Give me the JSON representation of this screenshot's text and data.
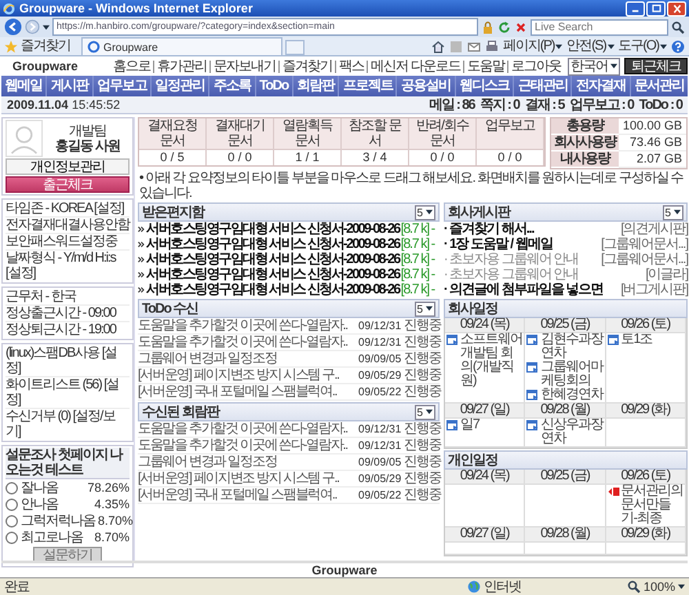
{
  "browser": {
    "title": "Groupware - Windows Internet Explorer",
    "url": "https://m.hanbiro.com/groupware/?category=index&section=main",
    "search_placeholder": "Live Search",
    "favorites": "즐겨찾기",
    "tab": "Groupware",
    "tools": [
      "페이지(P)",
      "안전(S)",
      "도구(O)"
    ]
  },
  "header": {
    "logo": "Groupware",
    "links": [
      "홈으로",
      "휴가관리",
      "문자보내기",
      "즐겨찾기",
      "팩스",
      "메신저 다운로드",
      "도움말",
      "로그아웃"
    ],
    "language": "한국어",
    "checkout_button": "퇴근체크"
  },
  "nav": [
    {
      "label": "웹메일"
    },
    {
      "label": "게시판"
    },
    {
      "label": "업무보고"
    },
    {
      "label": "일정관리"
    },
    {
      "label": "주소록"
    },
    {
      "label": "ToDo"
    },
    {
      "label": "회람판"
    },
    {
      "label": "프로젝트"
    },
    {
      "label": "공용설비"
    },
    {
      "label": "웹디스크"
    },
    {
      "label": "근태관리"
    },
    {
      "label": "전자결재"
    },
    {
      "label": "문서관리"
    }
  ],
  "datetime": {
    "date": "2009.11.04",
    "time": "15:45:52"
  },
  "counters": [
    {
      "label": "메일 :",
      "value": "86"
    },
    {
      "label": "쪽지 :",
      "value": "0"
    },
    {
      "label": "결재 :",
      "value": "5"
    },
    {
      "label": "업무보고 :",
      "value": "0"
    },
    {
      "label": "ToDo :",
      "value": "0"
    }
  ],
  "profile": {
    "team": "개발팀",
    "name": "홍길동 사원",
    "info_button": "개인정보관리",
    "checkin_button": "출근체크"
  },
  "settings_groups": [
    {
      "items": [
        "타임존 - KOREA [설정]",
        "전자결재대결사용안함",
        "보안패스워드설정중",
        "날짜형식 - Y/m/d H:i:s [설정]"
      ]
    },
    {
      "items": [
        "근무처 - 한국",
        "정상출근시간 - 09:00",
        "정상퇴근시간 - 19:00"
      ]
    },
    {
      "items": [
        "(linux)스팸DB사용 [설정]",
        "화이트리스트 (56) [설정]",
        "수신거부 (0) [설정/보기]"
      ]
    }
  ],
  "survey": {
    "title": "설문조사 첫페이지 나오는것 테스트",
    "options": [
      {
        "label": "잘나옴",
        "percent": "78.26%",
        "selected": false
      },
      {
        "label": "안나옴",
        "percent": "4.35%",
        "selected": false
      },
      {
        "label": "그럭저럭나옴",
        "percent": "8.70%",
        "selected": false
      },
      {
        "label": "최고로나옴",
        "percent": "8.70%",
        "selected": false
      }
    ],
    "button": "설문하기",
    "button_disabled": true
  },
  "summary": [
    {
      "label": "결재요청 문서",
      "value": "0 / 5"
    },
    {
      "label": "결재대기 문서",
      "value": "0 / 0"
    },
    {
      "label": "열람획득 문서",
      "value": "1 / 1"
    },
    {
      "label": "참조할 문서",
      "value": "3 / 4"
    },
    {
      "label": "반려/회수 문서",
      "value": "0 / 0"
    },
    {
      "label": "업무보고",
      "value": "0 / 0"
    }
  ],
  "storage": [
    {
      "label": "총용량",
      "value": "100.00 GB"
    },
    {
      "label": "회사사용량",
      "value": "73.46 GB"
    },
    {
      "label": "내사용량",
      "value": "2.07 GB"
    }
  ],
  "note": "• 아래 각 요약정보의 타이틀 부분을 마우스로 드래그 해보세요. 화면배치를 원하시는데로 구성하실 수 있습니다.",
  "inbox": {
    "title": "받은편지함",
    "count": "5",
    "items": [
      {
        "title": "서버호스팅영구임대형 서비스 신청서-2009-08-26",
        "size": "[8.7 k] -"
      },
      {
        "title": "서버호스팅영구임대형 서비스 신청서-2009-08-26",
        "size": "[8.7 k] -"
      },
      {
        "title": "서버호스팅영구임대형 서비스 신청서-2009-08-26",
        "size": "[8.7 k] -"
      },
      {
        "title": "서버호스팅영구임대형 서비스 신청서-2009-08-26",
        "size": "[8.7 k] -"
      },
      {
        "title": "서버호스팅영구임대형 서비스 신청서-2009-08-26",
        "size": "[8.7 k] -"
      }
    ]
  },
  "todo": {
    "title": "ToDo 수신",
    "count": "5",
    "rows": [
      {
        "title": "도움말을 추가할것 이곳에 쓴다-열람자..",
        "date": "09/12/31",
        "status": "진행중"
      },
      {
        "title": "도움말을 추가할것 이곳에 쓴다-열람자..",
        "date": "09/12/31",
        "status": "진행중"
      },
      {
        "title": "그룹웨어 변경과 일정조정",
        "date": "09/09/05",
        "status": "진행중"
      },
      {
        "title": "[서버운영] 페이지변조 방지 시스템 구..",
        "date": "09/05/29",
        "status": "진행중"
      },
      {
        "title": "[서버운영] 국내 포털메일 스팸블럭여..",
        "date": "09/05/22",
        "status": "진행중"
      }
    ]
  },
  "circular": {
    "title": "수신된 회람판",
    "count": "5",
    "rows": [
      {
        "title": "도움말을 추가할것 이곳에 쓴다-열람자..",
        "date": "09/12/31",
        "status": "진행중"
      },
      {
        "title": "도움말을 추가할것 이곳에 쓴다-열람자..",
        "date": "09/12/31",
        "status": "진행중"
      },
      {
        "title": "그룹웨어 변경과 일정조정",
        "date": "09/09/05",
        "status": "진행중"
      },
      {
        "title": "[서버운영] 페이지변조 방지 시스템 구..",
        "date": "09/05/29",
        "status": "진행중"
      },
      {
        "title": "[서버운영] 국내 포털메일 스팸블럭여..",
        "date": "09/05/22",
        "status": "진행중"
      }
    ]
  },
  "board": {
    "title": "회사게시판",
    "count": "5",
    "items": [
      {
        "title": "· 즐겨찾기 해서...",
        "board": "[의견게시판]",
        "unread": true
      },
      {
        "title": "· 1장 도움말 / 웹메일",
        "board": "[그룹웨어문서...]",
        "unread": true
      },
      {
        "title": "· 초보자용 그룹웨어 안내",
        "board": "[그룹웨어문서...]",
        "unread": false
      },
      {
        "title": "· 초보자용 그룹웨어 안내",
        "board": "[이글라]",
        "unread": false
      },
      {
        "title": "· 의견글에 첨부파일을 넣으면",
        "board": "[버그게시판]",
        "unread": true
      }
    ]
  },
  "company_schedule": {
    "title": "회사일정",
    "weeks": [
      {
        "days": [
          {
            "date": "09/24 (목)",
            "events": [
              {
                "text": "소프트웨어개발팀 회의(개발직원)",
                "kind": "company"
              }
            ]
          },
          {
            "date": "09/25 (금)",
            "events": [
              {
                "text": "김현수과장 연차",
                "kind": "company"
              },
              {
                "text": "그룹웨어마케팅회의",
                "kind": "company"
              },
              {
                "text": "한혜경연차",
                "kind": "company"
              }
            ]
          },
          {
            "date": "09/26 (토)",
            "events": [
              {
                "text": "토1조",
                "kind": "company"
              }
            ]
          }
        ]
      },
      {
        "days": [
          {
            "date": "09/27 (일)",
            "events": [
              {
                "text": "일7",
                "kind": "company"
              }
            ]
          },
          {
            "date": "09/28 (월)",
            "events": [
              {
                "text": "신상우과장 연차",
                "kind": "company"
              }
            ]
          },
          {
            "date": "09/29 (화)"
          }
        ]
      }
    ]
  },
  "personal_schedule": {
    "title": "개인일정",
    "weeks": [
      {
        "days": [
          {
            "date": "09/24 (목)"
          },
          {
            "date": "09/25 (금)"
          },
          {
            "date": "09/26 (토)",
            "events": [
              {
                "text": "문서관리의 문서만들기-최종",
                "kind": "task"
              }
            ]
          }
        ]
      },
      {
        "days": [
          {
            "date": "09/27 (일)"
          },
          {
            "date": "09/28 (월)"
          },
          {
            "date": "09/29 (화)"
          }
        ]
      }
    ]
  },
  "footer": "Groupware",
  "status": {
    "text": "완료",
    "zone": "인터넷",
    "zoom": "100%"
  }
}
